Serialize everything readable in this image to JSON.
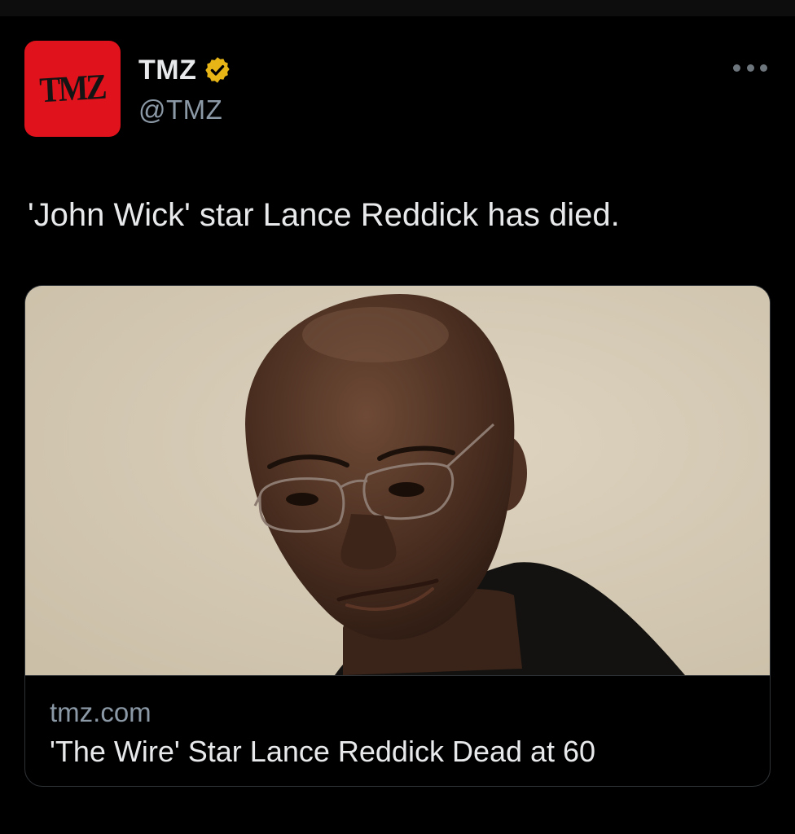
{
  "account": {
    "avatar_text": "TMZ",
    "display_name": "TMZ",
    "handle": "@TMZ",
    "verified_icon": "verified-badge-icon",
    "brand_color": "#e0121b",
    "verified_color": "#e8b516"
  },
  "menu": {
    "icon": "more-options-icon"
  },
  "tweet": {
    "text": "'John Wick' star Lance Reddick has died."
  },
  "link_card": {
    "image_alt_icon": "article-photo",
    "domain": "tmz.com",
    "title": "'The Wire' Star Lance Reddick Dead at 60"
  }
}
